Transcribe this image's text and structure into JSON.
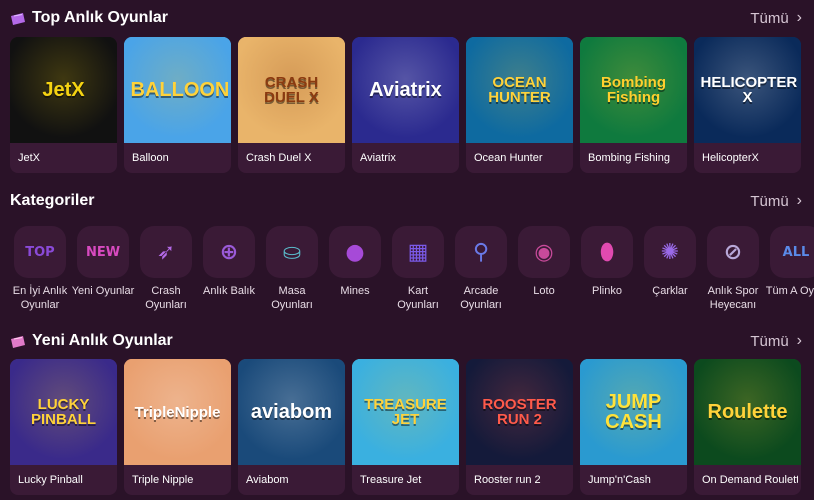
{
  "top_section": {
    "title": "Top Anlık Oyunlar",
    "see_all": "Tümü",
    "icon": "ticket-icon",
    "games": [
      {
        "name": "JetX",
        "logo": "JetX",
        "bg": "#111111",
        "accent": "#f5d312"
      },
      {
        "name": "Balloon",
        "logo": "BALLOON",
        "bg": "#4aa4e8",
        "accent": "#ffd23a"
      },
      {
        "name": "Crash Duel X",
        "logo": "CRASH DUEL X",
        "bg": "#e9b46a",
        "accent": "#8a3a10"
      },
      {
        "name": "Aviatrix",
        "logo": "Aviatrix",
        "bg": "#2b2a8f",
        "accent": "#ffffff"
      },
      {
        "name": "Ocean Hunter",
        "logo": "OCEAN HUNTER",
        "bg": "#0e6aa0",
        "accent": "#ffd23a"
      },
      {
        "name": "Bombing Fishing",
        "logo": "Bombing Fishing",
        "bg": "#0f7a3e",
        "accent": "#ffcf2e"
      },
      {
        "name": "HelicopterX",
        "logo": "HELICOPTER X",
        "bg": "#0a2a5a",
        "accent": "#ffffff"
      }
    ]
  },
  "categories_section": {
    "title": "Kategoriler",
    "see_all": "Tümü",
    "items": [
      {
        "label": "En İyi Anlık Oyunlar",
        "icon": "top-badge-icon",
        "color": "#8a4ad8"
      },
      {
        "label": "Yeni Oyunlar",
        "icon": "new-badge-icon",
        "color": "#d84ac0"
      },
      {
        "label": "Crash Oyunları",
        "icon": "rocket-icon",
        "color": "#b46ae8"
      },
      {
        "label": "Anlık Balık",
        "icon": "crosshair-icon",
        "color": "#9a5ad8"
      },
      {
        "label": "Masa Oyunları",
        "icon": "table-game-icon",
        "color": "#5ab8c8"
      },
      {
        "label": "Mines",
        "icon": "bomb-icon",
        "color": "#a64ad8"
      },
      {
        "label": "Kart Oyunları",
        "icon": "cards-icon",
        "color": "#7a5ae8"
      },
      {
        "label": "Arcade Oyunları",
        "icon": "joystick-icon",
        "color": "#6a7ae8"
      },
      {
        "label": "Loto",
        "icon": "lotto-ball-icon",
        "color": "#c84a9a"
      },
      {
        "label": "Plinko",
        "icon": "plinko-icon",
        "color": "#e04ab0"
      },
      {
        "label": "Çarklar",
        "icon": "wheel-icon",
        "color": "#9a6ae8"
      },
      {
        "label": "Anlık Spor Heyecanı",
        "icon": "racket-icon",
        "color": "#b8a8d8"
      },
      {
        "label": "Tüm A Oyun",
        "icon": "all-games-icon",
        "color": "#5a8ae8"
      }
    ]
  },
  "new_section": {
    "title": "Yeni Anlık Oyunlar",
    "see_all": "Tümü",
    "icon": "ticket-icon",
    "games": [
      {
        "name": "Lucky Pinball",
        "logo": "LUCKY PINBALL",
        "bg": "#3a2a8a",
        "accent": "#ffd23a"
      },
      {
        "name": "Triple Nipple",
        "logo": "TripleNipple",
        "bg": "#e9a070",
        "accent": "#ffffff"
      },
      {
        "name": "Aviabom",
        "logo": "aviabom",
        "bg": "#1a4a7a",
        "accent": "#ffffff"
      },
      {
        "name": "Treasure Jet",
        "logo": "TREASURE JET",
        "bg": "#3ab0e0",
        "accent": "#ffd23a"
      },
      {
        "name": "Rooster run 2",
        "logo": "ROOSTER RUN 2",
        "bg": "#141a3a",
        "accent": "#ff5a4a"
      },
      {
        "name": "Jump'n'Cash",
        "logo": "JUMP CASH",
        "bg": "#2a9ad0",
        "accent": "#ffe23a"
      },
      {
        "name": "On Demand Roulette",
        "logo": "Roulette",
        "bg": "#0c4a1e",
        "accent": "#ffd23a"
      }
    ]
  }
}
